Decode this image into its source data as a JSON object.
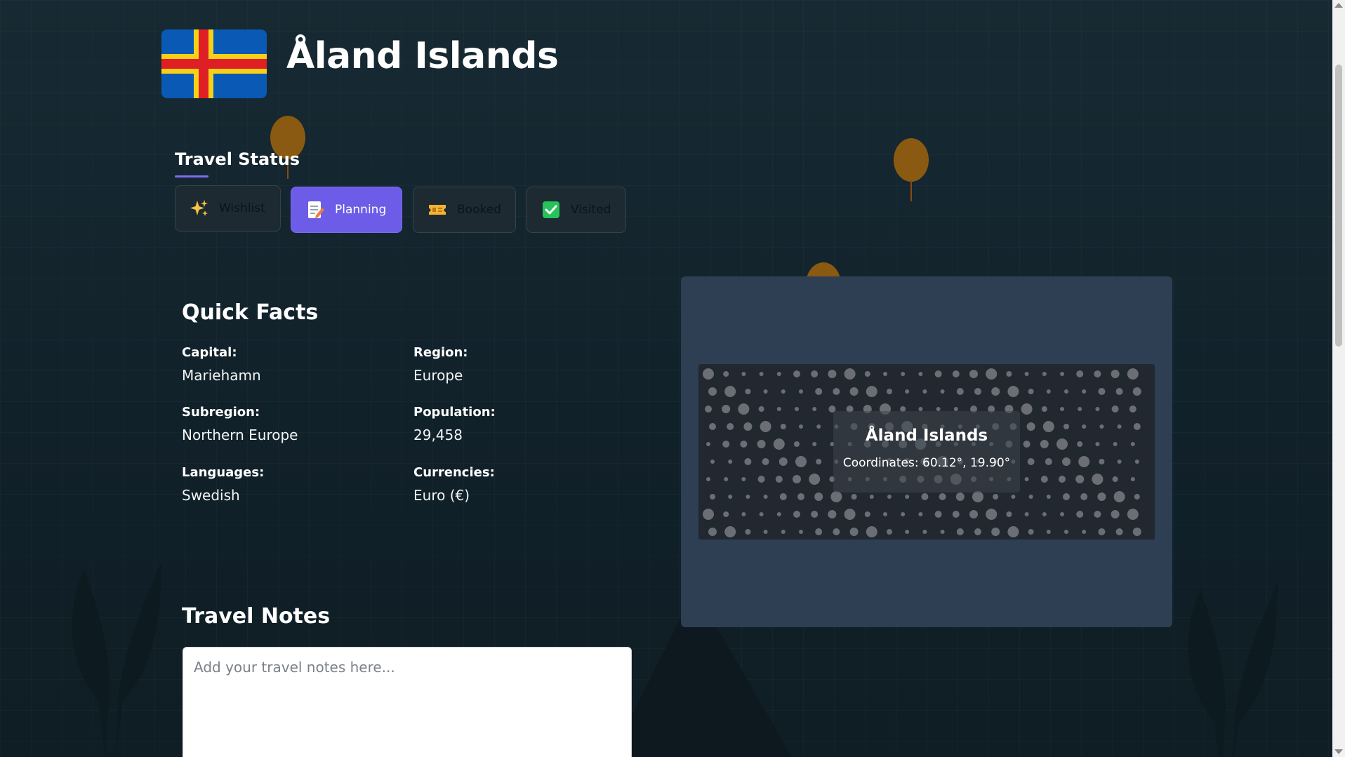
{
  "country": {
    "name": "Åland Islands",
    "flag_colors": {
      "field": "#0a59b4",
      "outer_cross": "#f7d117",
      "inner_cross": "#de1f26"
    }
  },
  "travel_status": {
    "title": "Travel Status",
    "options": [
      {
        "label": "Wishlist",
        "icon": "sparkles-icon",
        "active": false
      },
      {
        "label": "Planning",
        "icon": "memo-icon",
        "active": true
      },
      {
        "label": "Booked",
        "icon": "ticket-icon",
        "active": false
      },
      {
        "label": "Visited",
        "icon": "check-mark-icon",
        "active": false
      }
    ],
    "accent": "#6c5ce7"
  },
  "quick_facts": {
    "title": "Quick Facts",
    "items": [
      {
        "label": "Capital:",
        "value": "Mariehamn"
      },
      {
        "label": "Region:",
        "value": "Europe"
      },
      {
        "label": "Subregion:",
        "value": "Northern Europe"
      },
      {
        "label": "Population:",
        "value": "29,458"
      },
      {
        "label": "Languages:",
        "value": "Swedish"
      },
      {
        "label": "Currencies:",
        "value": "Euro (€)"
      }
    ]
  },
  "travel_notes": {
    "title": "Travel Notes",
    "placeholder": "Add your travel notes here...",
    "value": ""
  },
  "map": {
    "label": "Åland Islands",
    "coordinates_text": "Coordinates: 60.12°, 19.90°"
  }
}
